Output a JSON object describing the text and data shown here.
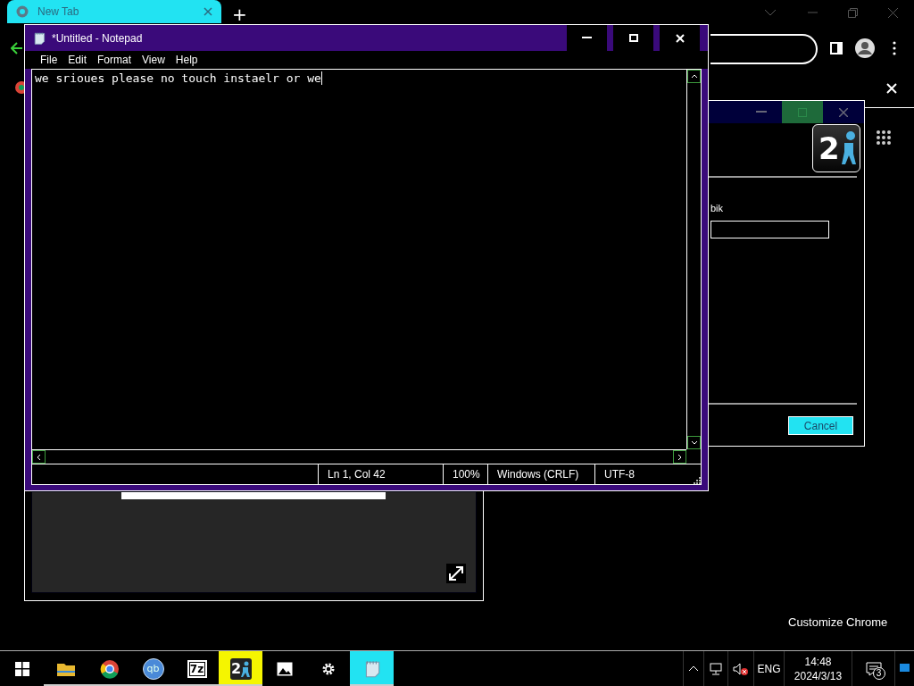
{
  "browser": {
    "tabs": [
      {
        "title": "New Tab",
        "selected": true
      }
    ],
    "new_tab": "+",
    "customize": "Customize Chrome"
  },
  "notepad": {
    "title": "*Untitled - Notepad",
    "menu": [
      "File",
      "Edit",
      "Format",
      "View",
      "Help"
    ],
    "text": "we srioues please no touch instaelr or we",
    "status": [
      "Ln 1, Col 42",
      "100%",
      "Windows (CRLF)",
      "UTF-8"
    ]
  },
  "installer": {
    "label": "bik",
    "logo": "2",
    "cancel": "Cancel"
  },
  "taskbar": {
    "apps": [
      {
        "kind": "folder",
        "selected": false,
        "running": true
      },
      {
        "kind": "chrome",
        "selected": false,
        "running": true
      },
      {
        "kind": "qb",
        "label": "qb",
        "selected": false,
        "running": true
      },
      {
        "kind": "sevenzip",
        "label": "7z",
        "selected": false,
        "running": true
      },
      {
        "kind": "portal",
        "label": "2",
        "selected": true,
        "running": true
      },
      {
        "kind": "photos",
        "selected": false,
        "running": false
      },
      {
        "kind": "settings",
        "selected": false,
        "running": false
      },
      {
        "kind": "notepad",
        "selected": true,
        "running": true
      }
    ],
    "language": "ENG",
    "time": "14:48",
    "date": "2024/3/13",
    "notifications": "3"
  }
}
